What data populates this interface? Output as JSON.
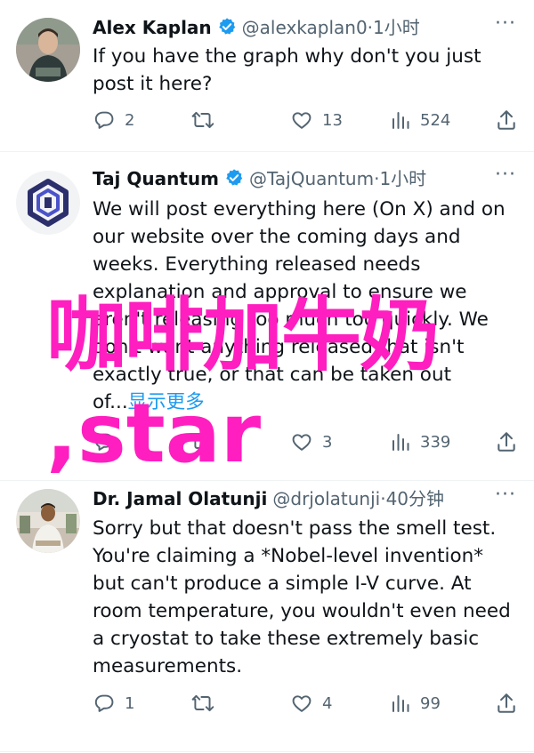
{
  "tweets": [
    {
      "name": "Alex Kaplan",
      "handle": "@alexkaplan0",
      "separator": "·",
      "time": "1小时",
      "lines": [
        "If you have the graph why don't you just",
        "post it here?"
      ],
      "replies": "2",
      "reposts": "",
      "likes": "13",
      "views": "524",
      "more_label": "···"
    },
    {
      "name": "Taj Quantum",
      "handle": "@TajQuantum",
      "separator": "·",
      "time": "1小时",
      "lines": [
        "We will post everything here (On X) and on",
        "our website over the coming days and",
        "weeks. Everything released needs",
        "explanation and approval to ensure we",
        "aren't releasing too much too quickly. We",
        "don't want anything released that isn't",
        "exactly true, or that can be taken out"
      ],
      "last_line_prefix": "of...",
      "show_more": "显示更多",
      "replies": "",
      "reposts": "",
      "likes": "3",
      "views": "339",
      "more_label": "···"
    },
    {
      "name": "Dr. Jamal Olatunji",
      "handle": "@drjolatunji",
      "separator": "·",
      "time": "40分钟",
      "lines": [
        "Sorry but that doesn't pass the smell test.",
        "You're claiming a *Nobel-level invention*",
        "but can't produce a simple I-V curve. At",
        "room temperature, you wouldn't even need",
        "a cryostat to take these extremely basic",
        "measurements."
      ],
      "replies": "1",
      "reposts": "",
      "likes": "4",
      "views": "99",
      "more_label": "···"
    }
  ],
  "watermark": {
    "line1": "咖啡加牛奶",
    "line2": ",star",
    "color": "#ff1ec0"
  },
  "colors": {
    "text": "#0f1419",
    "secondary": "#536471",
    "link": "#1d9bf0",
    "verified": "#1d9bf0"
  }
}
